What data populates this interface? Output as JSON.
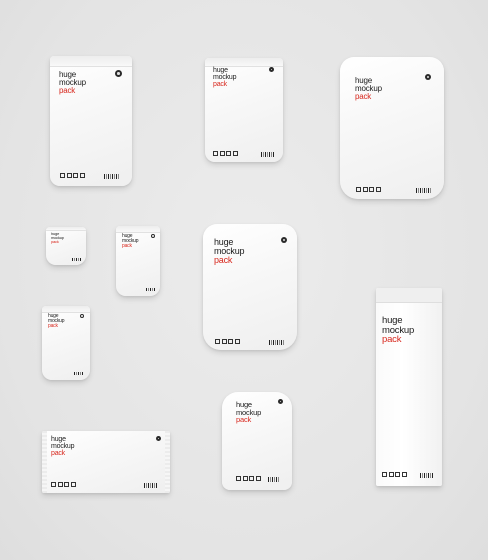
{
  "brand": {
    "line1": "huge",
    "line2": "mockup",
    "line3": "pack"
  },
  "colors": {
    "background": "#e6e6e6",
    "package": "#ffffff",
    "accent": "#d8281e",
    "text": "#1b1b1b"
  },
  "packages": [
    {
      "id": "tall-pouch-left"
    },
    {
      "id": "flat-pouch-top-center"
    },
    {
      "id": "stand-up-pouch-top-right"
    },
    {
      "id": "tiny-sachet"
    },
    {
      "id": "small-sachet"
    },
    {
      "id": "medium-sachet-left"
    },
    {
      "id": "large-pouch-center"
    },
    {
      "id": "milk-carton-right"
    },
    {
      "id": "bar-wrapper-bottom-left"
    },
    {
      "id": "bulging-pouch-bottom-center"
    }
  ]
}
